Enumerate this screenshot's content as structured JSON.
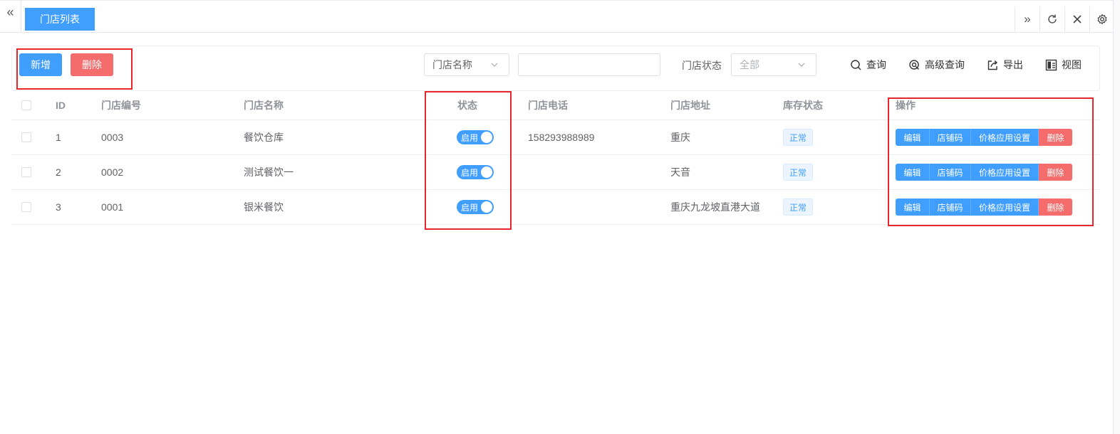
{
  "tabs": {
    "active_label": "门店列表"
  },
  "icons": {
    "collapse": "double-chevron-left-icon",
    "scroll_right": "double-chevron-right-icon",
    "refresh": "refresh-icon",
    "close": "close-icon",
    "settings": "gear-icon",
    "search": "search-icon",
    "advanced_search": "advanced-search-icon",
    "export": "export-icon",
    "view": "view-layout-icon"
  },
  "toolbar": {
    "add_label": "新增",
    "delete_label": "删除",
    "field_select_value": "门店名称",
    "search_value": "",
    "status_label": "门店状态",
    "status_select_value": "全部",
    "query_label": "查询",
    "advanced_query_label": "高级查询",
    "export_label": "导出",
    "view_label": "视图"
  },
  "table": {
    "headers": {
      "id": "ID",
      "code": "门店编号",
      "name": "门店名称",
      "state": "状态",
      "phone": "门店电话",
      "address": "门店地址",
      "stock": "库存状态",
      "ops": "操作"
    },
    "rows": [
      {
        "id": "1",
        "code": "0003",
        "name": "餐饮仓库",
        "state": "启用",
        "phone": "158293988989",
        "address": "重庆",
        "stock": "正常"
      },
      {
        "id": "2",
        "code": "0002",
        "name": "测试餐饮一",
        "state": "启用",
        "phone": "",
        "address": "天音",
        "stock": "正常"
      },
      {
        "id": "3",
        "code": "0001",
        "name": "银米餐饮",
        "state": "启用",
        "phone": "",
        "address": "重庆九龙坡直港大道",
        "stock": "正常"
      }
    ],
    "ops": {
      "edit": "编辑",
      "store_code": "店铺码",
      "price_settings": "价格应用设置",
      "delete": "删除"
    }
  },
  "colors": {
    "primary": "#409eff",
    "danger": "#f56c6c",
    "annotation": "#e8262b"
  }
}
